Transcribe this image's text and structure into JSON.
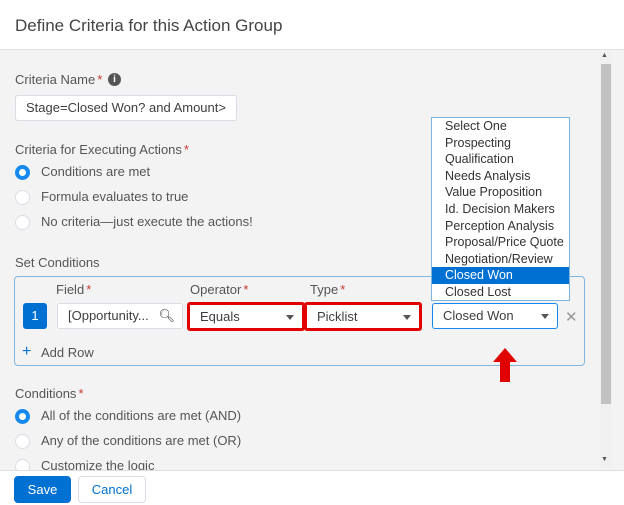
{
  "title": "Define Criteria for this Action Group",
  "criteria_name": {
    "label": "Criteria Name",
    "value": "Stage=Closed Won? and Amount>"
  },
  "executing": {
    "label": "Criteria for Executing Actions",
    "options": [
      "Conditions are met",
      "Formula evaluates to true",
      "No criteria—just execute the actions!"
    ],
    "selected": 0
  },
  "set_conditions": {
    "label": "Set Conditions",
    "field_label": "Field",
    "operator_label": "Operator",
    "type_label": "Type",
    "row_number": "1",
    "field_value": "[Opportunity...",
    "operator_value": "Equals",
    "type_value": "Picklist",
    "value": "Closed Won",
    "add_row": "Add Row"
  },
  "value_options": [
    "Select One",
    "Prospecting",
    "Qualification",
    "Needs Analysis",
    "Value Proposition",
    "Id. Decision Makers",
    "Perception Analysis",
    "Proposal/Price Quote",
    "Negotiation/Review",
    "Closed Won",
    "Closed Lost"
  ],
  "conditions": {
    "label": "Conditions",
    "options": [
      "All of the conditions are met (AND)",
      "Any of the conditions are met (OR)",
      "Customize the logic"
    ],
    "selected": 0
  },
  "footer": {
    "save": "Save",
    "cancel": "Cancel"
  },
  "colors": {
    "accent": "#0070d2",
    "highlight": "#e00000"
  }
}
